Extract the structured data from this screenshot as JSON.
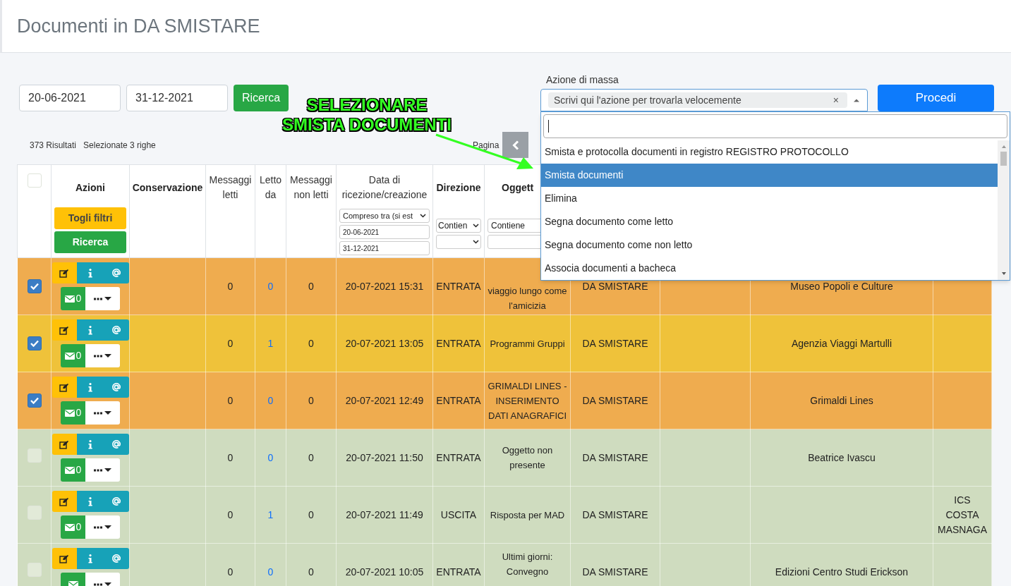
{
  "page_title": "Documenti in DA SMISTARE",
  "date_from": {
    "value": "20-06-2021"
  },
  "date_to": {
    "value": "31-12-2021"
  },
  "search_button": "Ricerca",
  "results": "373 Risultati",
  "selected_info": "Selezionate 3 righe",
  "annotation": {
    "lines": [
      "SELEZIONARE",
      "SMISTA DOCUMENTI"
    ]
  },
  "pagination": {
    "label": "Pagina"
  },
  "mass_action": {
    "label": "Azione di massa",
    "value": "Scrivi qui l'azione per trovarla velocemente",
    "clear": "×",
    "expanded": true,
    "options": [
      {
        "label": "Smista e protocolla documenti in registro REGISTRO PROTOCOLLO",
        "selected": false
      },
      {
        "label": "Smista documenti",
        "selected": true
      },
      {
        "label": "Elimina",
        "selected": false
      },
      {
        "label": "Segna documento come letto",
        "selected": false
      },
      {
        "label": "Segna documento come non letto",
        "selected": false
      },
      {
        "label": "Associa documenti a bacheca",
        "selected": false
      }
    ]
  },
  "proceed_button": "Procedi",
  "table": {
    "select_all": {
      "checked": false
    },
    "columns": [
      "Azioni",
      "Conservazione",
      "Messaggi letti",
      "Letto da",
      "Messaggi non letti",
      "Data di ricezione/creazione",
      "Direzione",
      "Oggett"
    ],
    "filters": {
      "clear_button": "Togli filtri",
      "search_button": "Ricerca",
      "date_mode": "Compreso tra (si est",
      "date_from": "20-06-2021",
      "date_to": "31-12-2021",
      "direction_mode": "Contien",
      "subject_mode": "Contiene"
    },
    "rows": [
      {
        "checked": true,
        "color": "#efac4f",
        "mail_count": "0",
        "messaggi_letti": "0",
        "letto_da": "0",
        "messaggi_non_letti": "0",
        "data": "20-07-2021 15:31",
        "direzione": "ENTRATA",
        "oggetto": "viaggio lungo come l'amicizia",
        "column_8": "DA SMISTARE",
        "column_10": "Museo Popoli e Culture"
      },
      {
        "checked": true,
        "color": "#efc23a",
        "mail_count": "0",
        "messaggi_letti": "0",
        "letto_da": "1",
        "messaggi_non_letti": "0",
        "data": "20-07-2021 13:05",
        "direzione": "ENTRATA",
        "oggetto": "Programmi Gruppi",
        "column_8": "DA SMISTARE",
        "column_10": "Agenzia Viaggi Martulli"
      },
      {
        "checked": true,
        "color": "#efac4f",
        "mail_count": "0",
        "messaggi_letti": "0",
        "letto_da": "0",
        "messaggi_non_letti": "0",
        "data": "20-07-2021 12:49",
        "direzione": "ENTRATA",
        "oggetto": "GRIMALDI LINES - INSERIMENTO DATI ANAGRAFICI",
        "column_8": "DA SMISTARE",
        "column_10": "Grimaldi Lines"
      },
      {
        "checked": false,
        "color": "#cfdcbf",
        "mail_count": "0",
        "messaggi_letti": "0",
        "letto_da": "0",
        "messaggi_non_letti": "0",
        "data": "20-07-2021 11:50",
        "direzione": "ENTRATA",
        "oggetto": "Oggetto non presente",
        "column_8": "DA SMISTARE",
        "column_10": "Beatrice Ivascu"
      },
      {
        "checked": false,
        "color": "#cfdcbf",
        "mail_count": "0",
        "messaggi_letti": "0",
        "letto_da": "1",
        "messaggi_non_letti": "0",
        "data": "20-07-2021 11:49",
        "direzione": "USCITA",
        "oggetto": "Risposta per MAD",
        "column_8": "DA SMISTARE",
        "column_11": "ICS COSTA MASNAGA"
      },
      {
        "checked": false,
        "color": "#cfdcbf",
        "messaggi_letti": "0",
        "letto_da": "0",
        "messaggi_non_letti": "0",
        "data": "20-07-2021 10:05",
        "direzione": "ENTRATA",
        "oggetto": "Ultimi giorni: Convegno",
        "column_8": "DA SMISTARE",
        "column_10": "Edizioni Centro Studi Erickson"
      }
    ]
  }
}
